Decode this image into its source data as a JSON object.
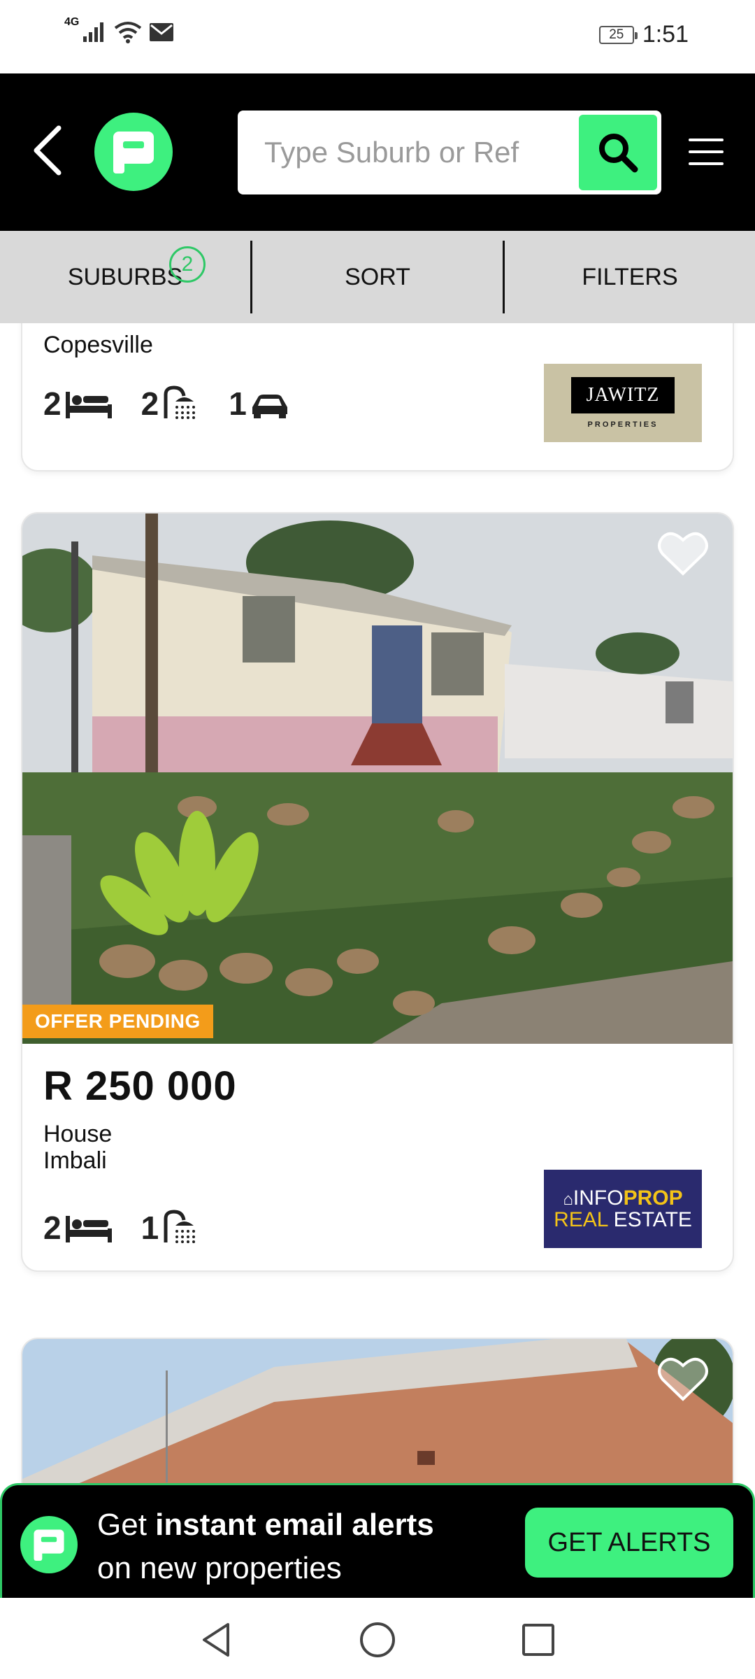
{
  "status_bar": {
    "network": "4G",
    "battery": "25",
    "time": "1:51"
  },
  "header": {
    "search_placeholder": "Type Suburb or Ref"
  },
  "filter_bar": {
    "suburbs_label": "SUBURBS",
    "suburbs_count": "2",
    "sort_label": "SORT",
    "filters_label": "FILTERS"
  },
  "listings": [
    {
      "suburb": "Copesville",
      "bedrooms": "2",
      "bathrooms": "2",
      "parking": "1",
      "agency": {
        "name": "JAWITZ",
        "sub": "PROPERTIES"
      }
    },
    {
      "badge": "OFFER PENDING",
      "price": "R 250 000",
      "type": "House",
      "suburb": "Imbali",
      "bedrooms": "2",
      "bathrooms": "1",
      "agency": {
        "line1_a": "INFO",
        "line1_b": "PROP",
        "line2_a": "REAL",
        "line2_b": " ESTATE"
      }
    }
  ],
  "alert_banner": {
    "text_pre": "Get ",
    "text_bold": "instant email alerts",
    "text_line2": "on new properties",
    "button_label": "GET ALERTS"
  },
  "colors": {
    "brand_green": "#3ef07f",
    "offer_orange": "#f39c1a",
    "header_bg": "#000000",
    "filter_bg": "#d9d9d9"
  }
}
